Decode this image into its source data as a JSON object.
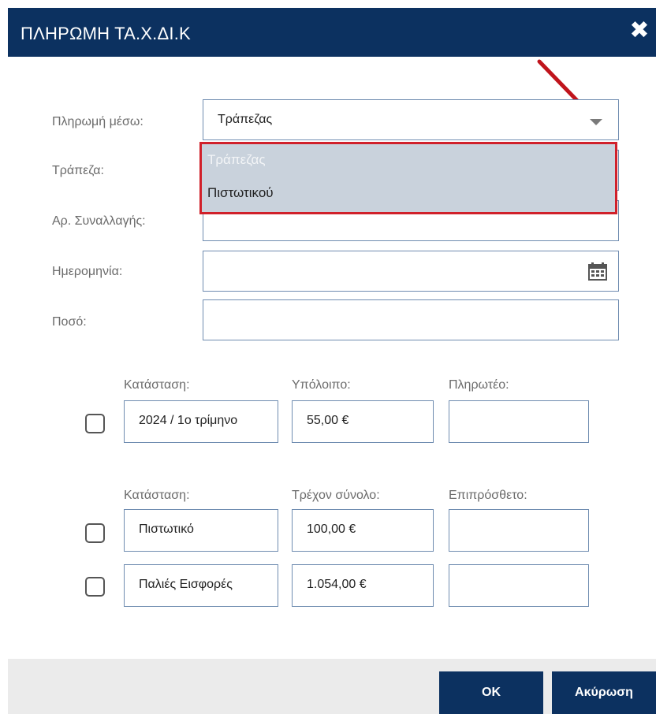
{
  "dialog": {
    "title": "ΠΛΗΡΩΜΗ ΤΑ.Χ.ΔΙ.Κ",
    "close_symbol": "✖"
  },
  "form": {
    "payment_method_label": "Πληρωμή μέσω:",
    "payment_method_value": "Τράπεζας",
    "payment_method_options": [
      "Τράπεζας",
      "Πιστωτικού"
    ],
    "bank_label": "Τράπεζα:",
    "transaction_label": "Αρ. Συναλλαγής:",
    "date_label": "Ημερομηνία:",
    "amount_label": "Ποσό:"
  },
  "section1": {
    "headers": [
      "Κατάσταση:",
      "Υπόλοιπο:",
      "Πληρωτέο:"
    ],
    "rows": [
      {
        "status": "2024 / 1ο τρίμηνο",
        "balance": "55,00 €",
        "payable": ""
      }
    ]
  },
  "section2": {
    "headers": [
      "Κατάσταση:",
      "Τρέχον σύνολο:",
      "Επιπρόσθετο:"
    ],
    "rows": [
      {
        "status": "Πιστωτικό",
        "total": "100,00 €",
        "additional": ""
      },
      {
        "status": "Παλιές Εισφορές",
        "total": "1.054,00 €",
        "additional": ""
      }
    ]
  },
  "buttons": {
    "ok": "OK",
    "cancel": "Ακύρωση"
  },
  "icons": [
    "close-icon",
    "dropdown-arrow-icon",
    "calendar-icon",
    "red-pointer-arrow"
  ],
  "colors": {
    "header_bg": "#0c3160",
    "highlight_border": "#d0202a",
    "dropdown_bg": "#c9d2dc",
    "footer_bg": "#ebebeb"
  }
}
